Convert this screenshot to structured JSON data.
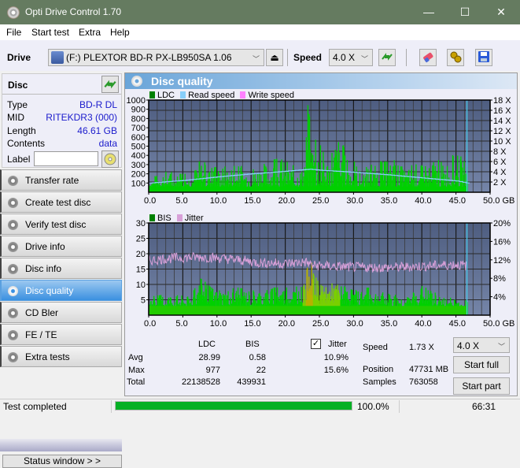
{
  "window": {
    "title": "Opti Drive Control 1.70",
    "minimize": "—",
    "maximize": "☐",
    "close": "✕"
  },
  "menu": [
    "File",
    "Start test",
    "Extra",
    "Help"
  ],
  "toolbar": {
    "drive_label": "Drive",
    "drive_value": "(F:)  PLEXTOR BD-R  PX-LB950SA 1.06",
    "eject_glyph": "⏏",
    "speed_label": "Speed",
    "speed_value": "4.0 X",
    "chevron": "﹀"
  },
  "disc": {
    "header": "Disc",
    "rows": [
      {
        "key": "Type",
        "value": "BD-R DL"
      },
      {
        "key": "MID",
        "value": "RITEKDR3 (000)"
      },
      {
        "key": "Length",
        "value": "46.61 GB"
      },
      {
        "key": "Contents",
        "value": "data"
      }
    ],
    "label_key": "Label",
    "label_value": ""
  },
  "nav": [
    {
      "label": "Transfer rate",
      "active": false
    },
    {
      "label": "Create test disc",
      "active": false
    },
    {
      "label": "Verify test disc",
      "active": false
    },
    {
      "label": "Drive info",
      "active": false
    },
    {
      "label": "Disc info",
      "active": false
    },
    {
      "label": "Disc quality",
      "active": true
    },
    {
      "label": "CD Bler",
      "active": false
    },
    {
      "label": "FE / TE",
      "active": false
    },
    {
      "label": "Extra tests",
      "active": false
    }
  ],
  "status_window_button": "Status window > >",
  "main": {
    "title": "Disc quality"
  },
  "chart_data": [
    {
      "type": "bar",
      "title": "LDC / Read speed",
      "legend": [
        {
          "name": "LDC",
          "color": "#008000"
        },
        {
          "name": "Read speed",
          "color": "#87cefa"
        },
        {
          "name": "Write speed",
          "color": "#ff80ff"
        }
      ],
      "legend_position": "top-left",
      "x_range": [
        0,
        50
      ],
      "x_ticks": [
        "0.0",
        "5.0",
        "10.0",
        "15.0",
        "20.0",
        "25.0",
        "30.0",
        "35.0",
        "40.0",
        "45.0",
        "50.0 GB"
      ],
      "y_left_range": [
        0,
        1000
      ],
      "y_left_ticks": [
        "100",
        "200",
        "300",
        "400",
        "500",
        "600",
        "700",
        "800",
        "900",
        "1000"
      ],
      "y_right_range": [
        0,
        18
      ],
      "y_right_ticks": [
        "2 X",
        "4 X",
        "6 X",
        "8 X",
        "10 X",
        "12 X",
        "14 X",
        "16 X",
        "18 X"
      ],
      "grid": true,
      "end_marker_x": 46.61,
      "ldc_envelope": {
        "x": [
          0,
          2,
          4,
          6,
          7.5,
          9,
          11,
          13,
          15,
          17,
          19,
          21,
          22.5,
          23.3,
          23.6,
          24,
          25,
          26,
          27,
          28,
          29,
          30,
          31,
          32,
          33,
          34,
          35,
          36,
          37,
          38,
          39,
          40,
          41,
          42,
          43,
          44,
          45,
          46,
          46.6
        ],
        "y": [
          120,
          250,
          200,
          200,
          370,
          260,
          300,
          280,
          300,
          330,
          370,
          300,
          260,
          990,
          720,
          600,
          520,
          400,
          620,
          640,
          350,
          400,
          200,
          320,
          280,
          340,
          330,
          350,
          290,
          270,
          320,
          300,
          260,
          360,
          330,
          380,
          430,
          380,
          260
        ],
        "base": 60
      },
      "read_speed": {
        "x": [
          0,
          5,
          10,
          15,
          20,
          23.5,
          25,
          30,
          35,
          40,
          45,
          46.6
        ],
        "y": [
          1.8,
          2.3,
          3.0,
          3.6,
          4.1,
          4.5,
          4.3,
          3.9,
          3.4,
          2.8,
          2.2,
          1.8
        ]
      }
    },
    {
      "type": "bar",
      "title": "BIS / Jitter",
      "legend": [
        {
          "name": "BIS",
          "color": "#008000"
        },
        {
          "name": "Jitter",
          "color": "#d8a0d8"
        }
      ],
      "legend_position": "top-left",
      "x_range": [
        0,
        50
      ],
      "x_ticks": [
        "0.0",
        "5.0",
        "10.0",
        "15.0",
        "20.0",
        "25.0",
        "30.0",
        "35.0",
        "40.0",
        "45.0",
        "50.0 GB"
      ],
      "y_left_range": [
        0,
        30
      ],
      "y_left_ticks": [
        "5",
        "10",
        "15",
        "20",
        "25",
        "30"
      ],
      "y_right_range": [
        0,
        20
      ],
      "y_right_ticks": [
        "4%",
        "8%",
        "12%",
        "16%",
        "20%"
      ],
      "grid": true,
      "end_marker_x": 46.61,
      "bis_envelope": {
        "x": [
          0,
          3,
          6,
          7.5,
          10,
          13,
          15,
          18,
          21,
          22.8,
          23.5,
          24,
          25,
          26,
          27,
          28,
          30,
          32,
          35,
          38,
          40,
          43,
          46.6
        ],
        "y": [
          6,
          7,
          6,
          12,
          8,
          9,
          8,
          9,
          9,
          10,
          22,
          14,
          10,
          9,
          11,
          10,
          8,
          9,
          7,
          6,
          10,
          6,
          5
        ]
      },
      "jitter_pct": {
        "x": [
          0,
          2,
          5,
          8,
          10,
          13,
          16,
          20,
          23,
          24,
          27,
          30,
          35,
          40,
          45,
          46.6
        ],
        "y": [
          11.8,
          12.2,
          12.5,
          12.6,
          12.4,
          12.0,
          11.4,
          11.2,
          11.5,
          10.8,
          10.6,
          10.4,
          10.3,
          10.6,
          11.0,
          10.7
        ]
      }
    }
  ],
  "stats": {
    "col_ldc": "LDC",
    "col_bis": "BIS",
    "jitter_label": "Jitter",
    "jitter_checked": true,
    "rows": [
      {
        "label": "Avg",
        "ldc": "28.99",
        "bis": "0.58",
        "jitter": "10.9%"
      },
      {
        "label": "Max",
        "ldc": "977",
        "bis": "22",
        "jitter": "15.6%"
      },
      {
        "label": "Total",
        "ldc": "22138528",
        "bis": "439931",
        "jitter": ""
      }
    ],
    "speed_label": "Speed",
    "speed_value": "1.73 X",
    "position_label": "Position",
    "position_value": "47731 MB",
    "samples_label": "Samples",
    "samples_value": "763058",
    "speed_select": "4.0 X",
    "start_full": "Start full",
    "start_part": "Start part"
  },
  "statusbar": {
    "text": "Test completed",
    "progress_pct": 100,
    "progress_text": "100.0%",
    "time": "66:31"
  }
}
